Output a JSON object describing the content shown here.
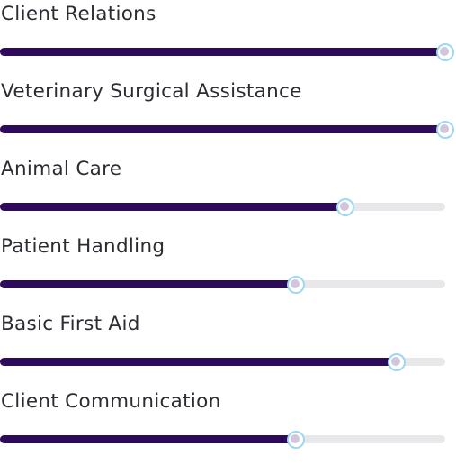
{
  "accent_color": "#2d0b5a",
  "track_color": "#e8e8ea",
  "thumb_border_color": "#9fd7f1",
  "skills": [
    {
      "label": "Client Relations",
      "value": 100
    },
    {
      "label": "Veterinary Surgical Assistance",
      "value": 100
    },
    {
      "label": "Animal Care",
      "value": 77.5
    },
    {
      "label": "Patient Handling",
      "value": 66.5
    },
    {
      "label": "Basic First Aid",
      "value": 89
    },
    {
      "label": "Client Communication",
      "value": 66.5
    }
  ]
}
